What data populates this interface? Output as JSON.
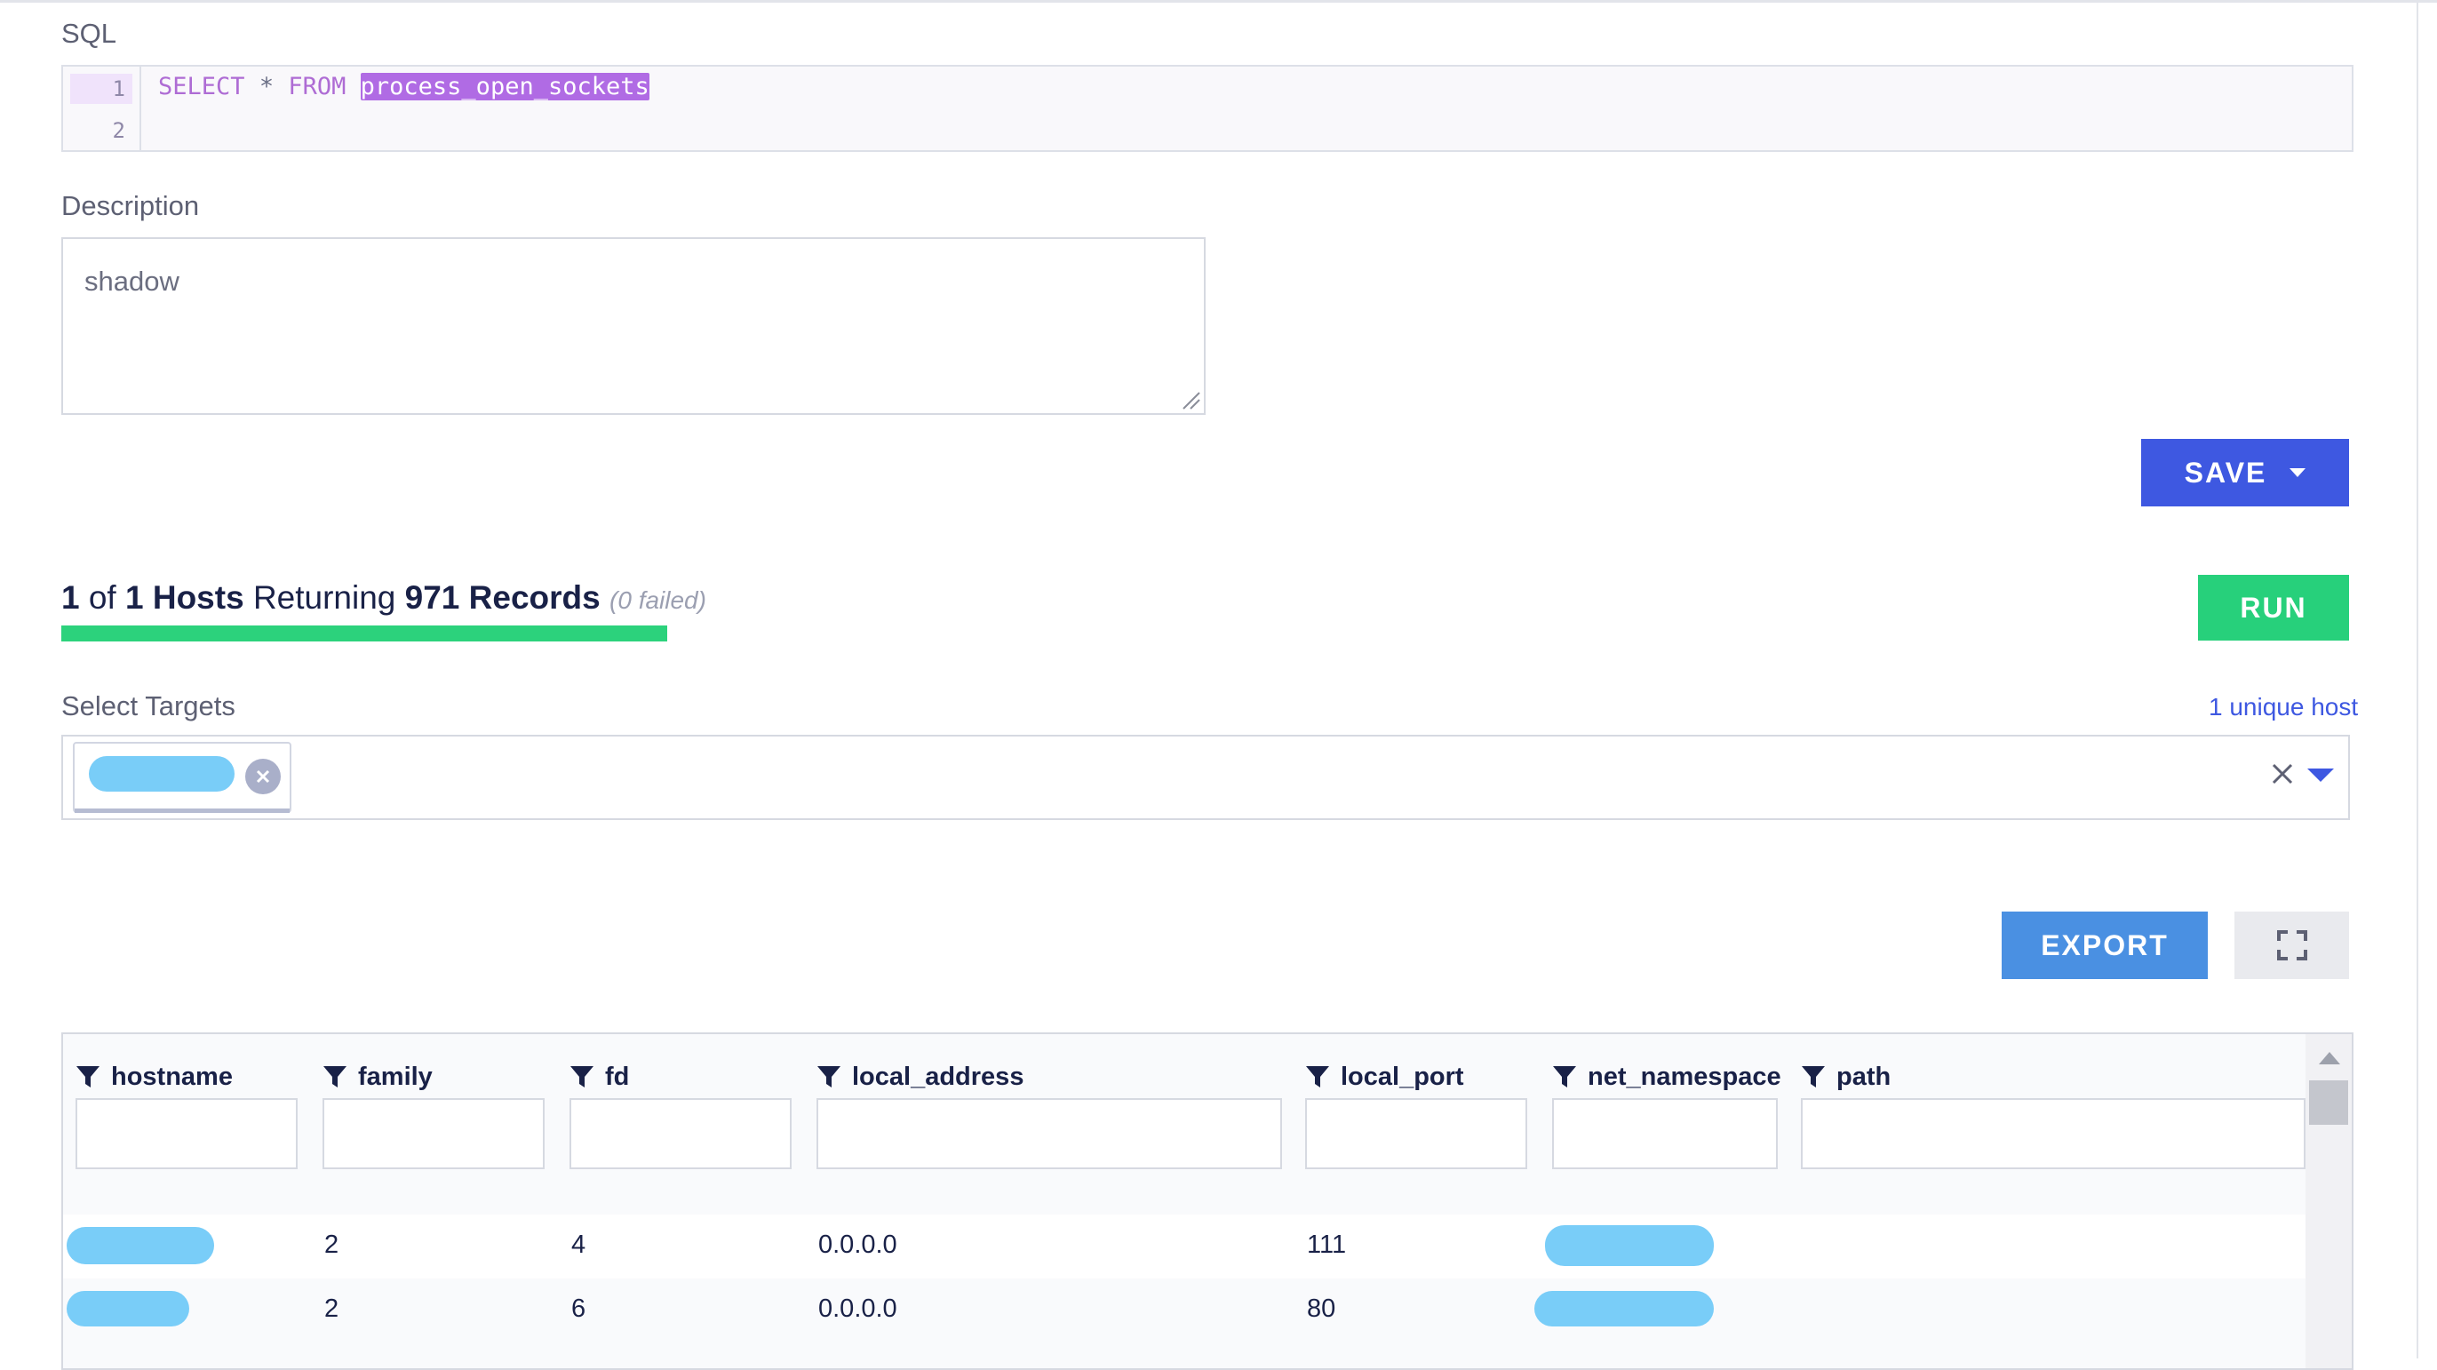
{
  "sql": {
    "label": "SQL",
    "line_numbers": [
      "1",
      "2"
    ],
    "code": {
      "kw_select": "SELECT",
      "star": "*",
      "kw_from": "FROM",
      "table": "process_open_sockets"
    }
  },
  "description": {
    "label": "Description",
    "value": "shadow"
  },
  "save_button": {
    "label": "SAVE"
  },
  "run_button": {
    "label": "RUN"
  },
  "status": {
    "hosts_done": "1",
    "of": "of",
    "hosts_total": "1 Hosts",
    "returning": "Returning",
    "records": "971 Records",
    "failed": "(0 failed)",
    "progress_fraction": 1.0
  },
  "targets": {
    "label": "Select Targets",
    "unique_hosts": "1 unique host"
  },
  "export_button": {
    "label": "EXPORT"
  },
  "colors": {
    "primary_blue": "#3e58e1",
    "run_green": "#27d07b",
    "export_blue": "#4a90e2",
    "sql_keyword": "#ae6cd4",
    "sql_selection": "#b06be4"
  },
  "table": {
    "columns": [
      "hostname",
      "family",
      "fd",
      "local_address",
      "local_port",
      "net_namespace",
      "path"
    ],
    "rows": [
      {
        "family": "2",
        "fd": "4",
        "local_address": "0.0.0.0",
        "local_port": "111"
      },
      {
        "family": "2",
        "fd": "6",
        "local_address": "0.0.0.0",
        "local_port": "80"
      }
    ]
  }
}
